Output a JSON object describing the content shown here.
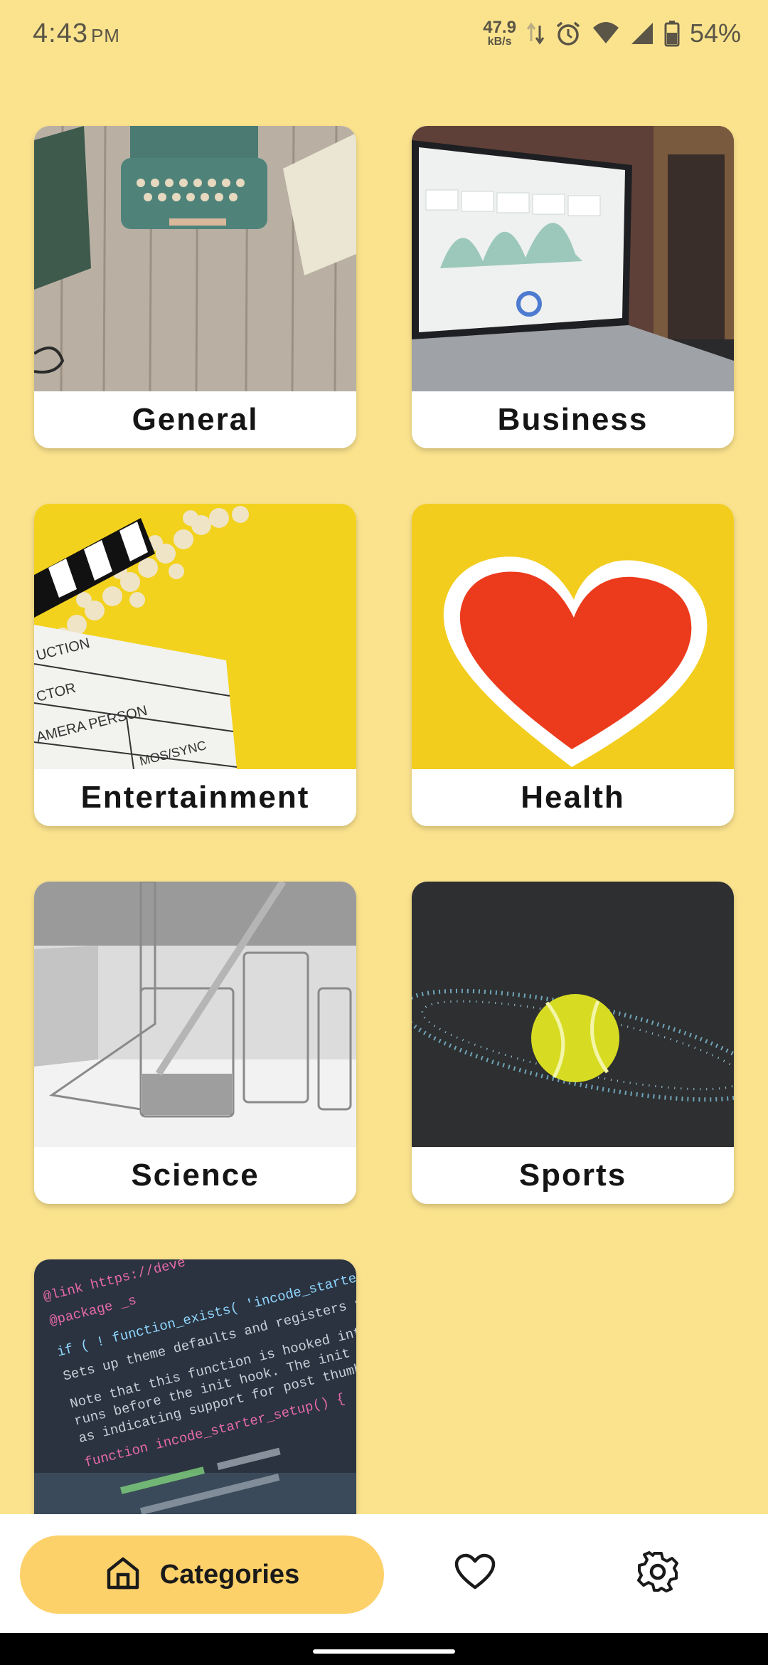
{
  "status_bar": {
    "time": "4:43",
    "ampm": "PM",
    "net_speed_value": "47.9",
    "net_speed_unit": "kB/s",
    "battery": "54%",
    "icons": [
      "data-arrows-icon",
      "alarm-icon",
      "wifi-icon",
      "signal-icon",
      "battery-icon"
    ]
  },
  "categories": [
    {
      "label": "General",
      "image": "typewriter-photo"
    },
    {
      "label": "Business",
      "image": "laptop-dashboard-photo"
    },
    {
      "label": "Entertainment",
      "image": "clapperboard-popcorn-photo"
    },
    {
      "label": "Health",
      "image": "heart-wall-photo"
    },
    {
      "label": "Science",
      "image": "lab-glassware-photo"
    },
    {
      "label": "Sports",
      "image": "tennis-ball-photo"
    },
    {
      "label": "",
      "image": "code-screen-photo"
    }
  ],
  "code_snippet": {
    "line1": "@link https://deve",
    "line2": "@package _s",
    "line3": "if ( ! function_exists( 'incode_starter_setup' ) ) :",
    "line4": "Sets up theme defaults and registers support for various",
    "line5": "Note that this function is hooked into the after_setup_the",
    "line6": "runs before the init hook. The init hook is too late for",
    "line7": "as indicating support for post thumbnails.",
    "line8": "function incode_starter_setup() {"
  },
  "bottom_nav": {
    "active_label": "Categories",
    "icons": [
      "home-icon",
      "heart-icon",
      "gear-icon"
    ]
  },
  "colors": {
    "background": "#fbe38e",
    "nav_pill": "#fdd16a",
    "card_label_bg": "#ffffff"
  }
}
